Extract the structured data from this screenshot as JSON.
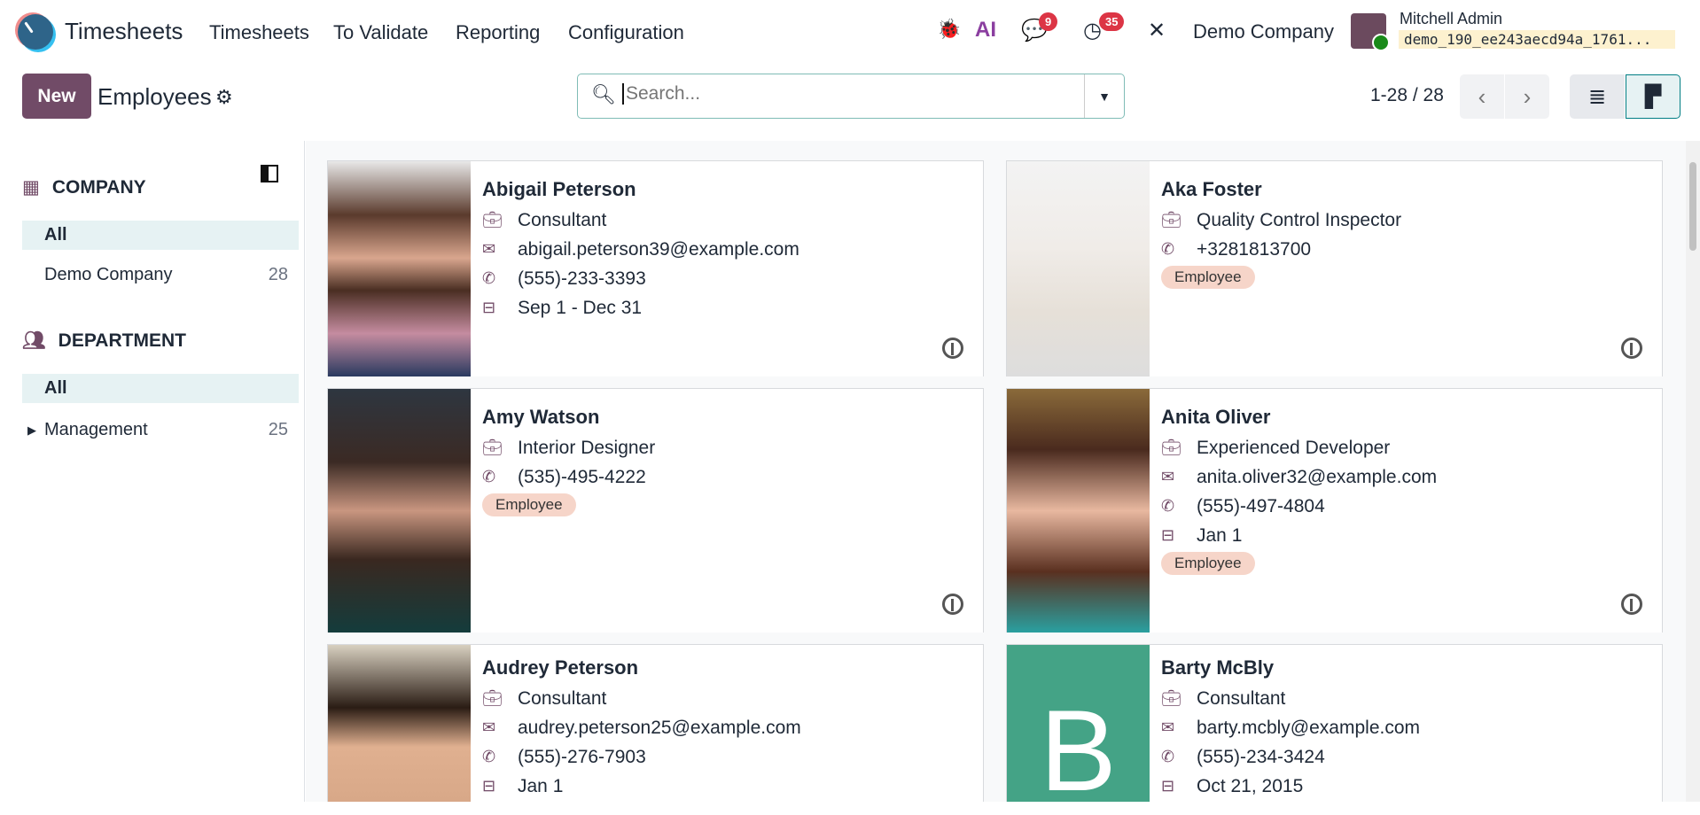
{
  "navbar": {
    "app_name": "Timesheets",
    "menu": [
      "Timesheets",
      "To Validate",
      "Reporting",
      "Configuration"
    ],
    "messages_count": "9",
    "activities_count": "35",
    "ai_label": "AI",
    "company": "Demo Company",
    "user_name": "Mitchell Admin",
    "database": "demo_190_ee243aecd94a_1761..."
  },
  "control": {
    "new_label": "New",
    "title": "Employees",
    "search_placeholder": "Search...",
    "pager": "1-28 / 28"
  },
  "sidebar": {
    "company_header": "COMPANY",
    "company_items": [
      {
        "label": "All",
        "count": ""
      },
      {
        "label": "Demo Company",
        "count": "28"
      }
    ],
    "department_header": "DEPARTMENT",
    "department_items": [
      {
        "label": "All",
        "count": ""
      },
      {
        "label": "Management",
        "count": "25"
      }
    ]
  },
  "colors": {
    "brand": "#714b67",
    "teal": "#017e84",
    "tag": "#f6d5c9",
    "barty_avatar": "#44a386"
  },
  "employees": [
    {
      "name": "Abigail Peterson",
      "job": "Consultant",
      "email": "abigail.peterson39@example.com",
      "phone": "(555)-233-3393",
      "contract": "Sep 1 - Dec 31",
      "tag": ""
    },
    {
      "name": "Aka Foster",
      "job": "Quality Control Inspector",
      "email": "",
      "phone": "+3281813700",
      "contract": "",
      "tag": "Employee"
    },
    {
      "name": "Amy Watson",
      "job": "Interior Designer",
      "email": "",
      "phone": "(535)-495-4222",
      "contract": "",
      "tag": "Employee"
    },
    {
      "name": "Anita Oliver",
      "job": "Experienced Developer",
      "email": "anita.oliver32@example.com",
      "phone": "(555)-497-4804",
      "contract": "Jan 1",
      "tag": "Employee"
    },
    {
      "name": "Audrey Peterson",
      "job": "Consultant",
      "email": "audrey.peterson25@example.com",
      "phone": "(555)-276-7903",
      "contract": "Jan 1",
      "tag": ""
    },
    {
      "name": "Barty McBly",
      "job": "Consultant",
      "email": "barty.mcbly@example.com",
      "phone": "(555)-234-3424",
      "contract": "Oct 21, 2015",
      "tag": "",
      "initial": "B"
    }
  ]
}
